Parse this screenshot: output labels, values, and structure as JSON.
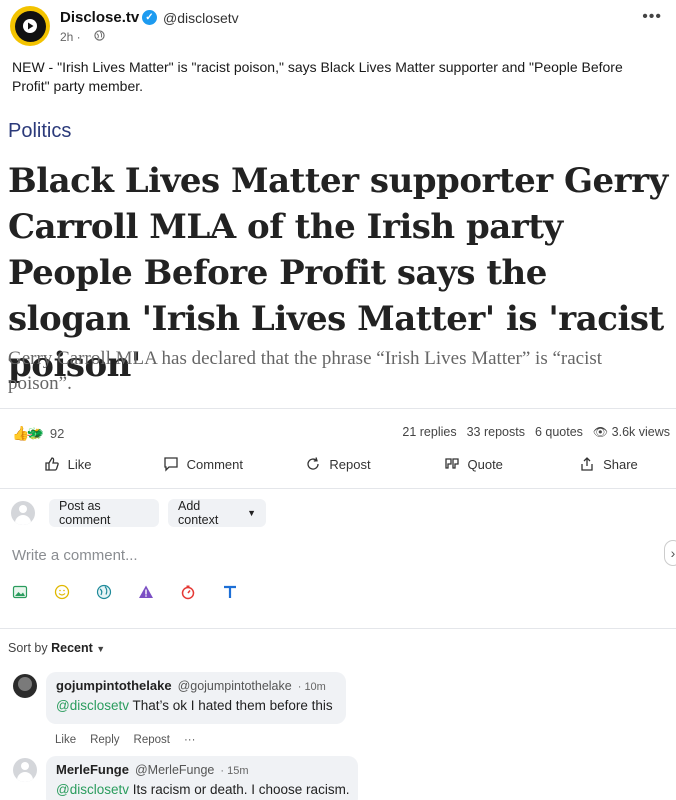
{
  "post": {
    "author": "Disclose.tv",
    "handle": "@disclosetv",
    "time": "2h ·",
    "more": "•••",
    "text": "NEW - \"Irish Lives Matter\" is \"racist poison,\" says Black Lives Matter supporter and \"People Before Profit\" party member."
  },
  "article": {
    "category": "Politics",
    "title": "Black Lives Matter supporter Gerry Carroll MLA of the Irish party People Before Profit says the slogan 'Irish Lives Matter' is 'racist poison'",
    "subtitle": "Gerry Carroll MLA has declared that the phrase “Irish Lives Matter” is “racist poison”."
  },
  "stats": {
    "reaction_count": "92",
    "replies": "21 replies",
    "reposts": "33 reposts",
    "quotes": "6 quotes",
    "views": "3.6k views"
  },
  "actions": {
    "like": "Like",
    "comment": "Comment",
    "repost": "Repost",
    "quote": "Quote",
    "share": "Share"
  },
  "composer": {
    "post_as": "Post as comment",
    "add_context": "Add context",
    "placeholder": "Write a comment...",
    "tools": [
      "image-icon",
      "emoji-icon",
      "globe-icon",
      "warning-icon",
      "timer-icon",
      "text-format-icon"
    ]
  },
  "sort": {
    "label": "Sort by",
    "value": "Recent"
  },
  "comments": [
    {
      "name": "gojumpintothelake",
      "handle": "@gojumpintothelake",
      "time": "· 10m",
      "mention": "@disclosetv",
      "text": " That’s ok I hated them before this",
      "like": "Like",
      "reply": "Reply",
      "repost": "Repost",
      "more": "···"
    },
    {
      "name": "MerleFunge",
      "handle": "@MerleFunge",
      "time": "· 15m",
      "mention": "@disclosetv",
      "text": " Its racism or death. I choose racism."
    }
  ],
  "colors": {
    "accent_blue": "#1d9bf0",
    "mention_green": "#2a9c5d",
    "category_blue": "#2b3a7a",
    "brand_yellow": "#f3c300"
  }
}
